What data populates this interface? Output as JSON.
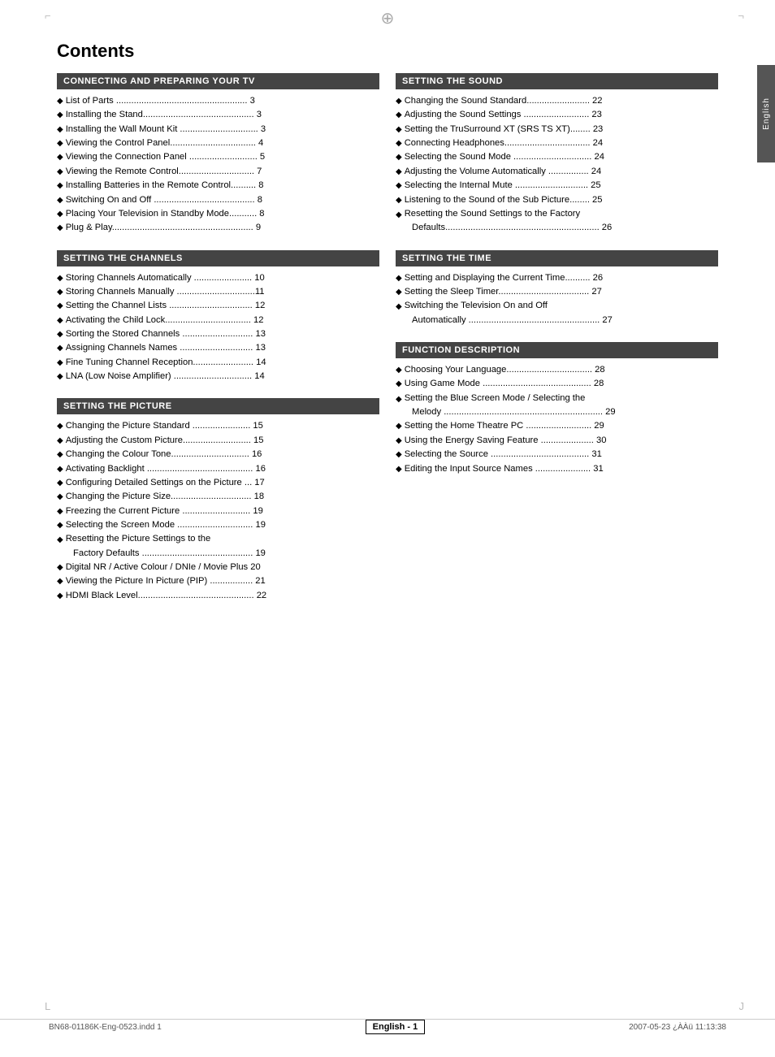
{
  "page": {
    "title": "Contents",
    "side_tab": "English",
    "footer": {
      "left": "BN68-01186K-Eng-0523.indd   1",
      "center": "English - 1",
      "right": "2007-05-23   ¿ÀÀü 11:13:38"
    }
  },
  "sections": {
    "left": [
      {
        "id": "connecting",
        "header": "CONNECTING AND PREPARING YOUR TV",
        "items": [
          {
            "text": "List of Parts",
            "dots": true,
            "page": "3"
          },
          {
            "text": "Installing the Stand",
            "dots": true,
            "page": "3"
          },
          {
            "text": "Installing the Wall Mount Kit",
            "dots": true,
            "page": "3"
          },
          {
            "text": "Viewing the Control Panel",
            "dots": true,
            "page": "4"
          },
          {
            "text": "Viewing the Connection Panel",
            "dots": true,
            "page": "5"
          },
          {
            "text": "Viewing the Remote Control",
            "dots": true,
            "page": "7"
          },
          {
            "text": "Installing Batteries in the Remote Control",
            "dots": true,
            "page": "8"
          },
          {
            "text": "Switching On and Off",
            "dots": true,
            "page": "8"
          },
          {
            "text": "Placing Your Television in Standby Mode",
            "dots": true,
            "page": "8"
          },
          {
            "text": "Plug & Play",
            "dots": true,
            "page": "9"
          }
        ]
      },
      {
        "id": "channels",
        "header": "SETTING THE CHANNELS",
        "items": [
          {
            "text": "Storing Channels Automatically",
            "dots": true,
            "page": "10"
          },
          {
            "text": "Storing Channels Manually",
            "dots": true,
            "page": "11"
          },
          {
            "text": "Setting the Channel Lists",
            "dots": true,
            "page": "12"
          },
          {
            "text": "Activating the Child Lock",
            "dots": true,
            "page": "12"
          },
          {
            "text": "Sorting the Stored Channels",
            "dots": true,
            "page": "13"
          },
          {
            "text": "Assigning Channels Names",
            "dots": true,
            "page": "13"
          },
          {
            "text": "Fine Tuning Channel Reception",
            "dots": true,
            "page": "14"
          },
          {
            "text": "LNA (Low Noise Amplifier)",
            "dots": true,
            "page": "14"
          }
        ]
      },
      {
        "id": "picture",
        "header": "SETTING THE PICTURE",
        "items": [
          {
            "text": "Changing the Picture Standard",
            "dots": true,
            "page": "15"
          },
          {
            "text": "Adjusting the Custom Picture",
            "dots": true,
            "page": "15"
          },
          {
            "text": "Changing the Colour Tone",
            "dots": true,
            "page": "16"
          },
          {
            "text": "Activating Backlight",
            "dots": true,
            "page": "16"
          },
          {
            "text": "Configuring Detailed Settings on the Picture",
            "dots": true,
            "page": "17"
          },
          {
            "text": "Changing the Picture Size",
            "dots": true,
            "page": "18"
          },
          {
            "text": "Freezing the Current Picture",
            "dots": true,
            "page": "19"
          },
          {
            "text": "Selecting the Screen Mode",
            "dots": true,
            "page": "19"
          },
          {
            "text": "Resetting the Picture Settings to the Factory Defaults",
            "dots": true,
            "page": "19",
            "multiline": true,
            "continuation": "Factory Defaults"
          },
          {
            "text": "Digital NR / Active Colour / DNIe / Movie Plus",
            "dots": true,
            "page": "20"
          },
          {
            "text": "Viewing the Picture In Picture (PIP)",
            "dots": true,
            "page": "21"
          },
          {
            "text": "HDMI Black Level",
            "dots": true,
            "page": "22"
          }
        ]
      }
    ],
    "right": [
      {
        "id": "sound",
        "header": "SETTING THE SOUND",
        "items": [
          {
            "text": "Changing the Sound Standard",
            "dots": true,
            "page": "22"
          },
          {
            "text": "Adjusting the Sound Settings",
            "dots": true,
            "page": "23"
          },
          {
            "text": "Setting the TruSurround XT (SRS TS XT)",
            "dots": true,
            "page": "23"
          },
          {
            "text": "Connecting Headphones",
            "dots": true,
            "page": "24"
          },
          {
            "text": "Selecting the Sound Mode",
            "dots": true,
            "page": "24"
          },
          {
            "text": "Adjusting the Volume Automatically",
            "dots": true,
            "page": "24"
          },
          {
            "text": "Selecting the Internal Mute",
            "dots": true,
            "page": "25"
          },
          {
            "text": "Listening to the Sound of the Sub Picture",
            "dots": true,
            "page": "25"
          },
          {
            "text": "Resetting the Sound Settings to the Factory Defaults",
            "dots": true,
            "page": "26",
            "multiline": true
          }
        ]
      },
      {
        "id": "time",
        "header": "SETTING THE TIME",
        "items": [
          {
            "text": "Setting and Displaying the Current Time",
            "dots": true,
            "page": "26"
          },
          {
            "text": "Setting the Sleep Timer",
            "dots": true,
            "page": "27"
          },
          {
            "text": "Switching the Television On and Off Automatically",
            "dots": true,
            "page": "27",
            "multiline": true
          }
        ]
      },
      {
        "id": "function",
        "header": "FUNCTION DESCRIPTION",
        "items": [
          {
            "text": "Choosing Your Language",
            "dots": true,
            "page": "28"
          },
          {
            "text": "Using Game Mode",
            "dots": true,
            "page": "28"
          },
          {
            "text": "Setting the Blue Screen Mode / Selecting the Melody",
            "dots": true,
            "page": "29",
            "multiline": true
          },
          {
            "text": "Setting the Home Theatre PC",
            "dots": true,
            "page": "29"
          },
          {
            "text": "Using the Energy Saving Feature",
            "dots": true,
            "page": "30"
          },
          {
            "text": "Selecting the Source",
            "dots": true,
            "page": "31"
          },
          {
            "text": "Editing the Input Source Names",
            "dots": true,
            "page": "31"
          }
        ]
      }
    ]
  }
}
